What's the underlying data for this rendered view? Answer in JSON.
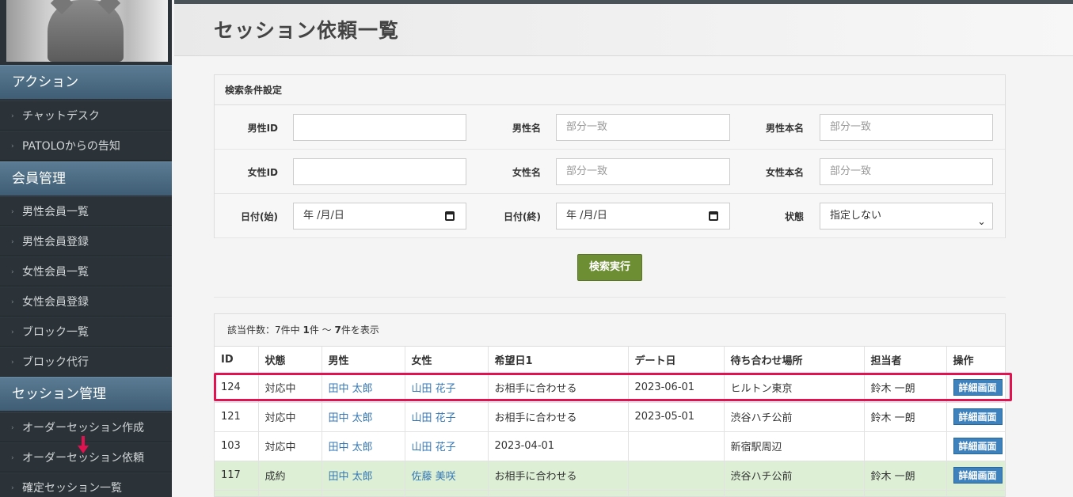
{
  "sidebar": {
    "sections": [
      {
        "title": "アクション",
        "items": [
          "チャットデスク",
          "PATOLOからの告知"
        ]
      },
      {
        "title": "会員管理",
        "items": [
          "男性会員一覧",
          "男性会員登録",
          "女性会員一覧",
          "女性会員登録",
          "ブロック一覧",
          "ブロック代行"
        ]
      },
      {
        "title": "セッション管理",
        "items": [
          "オーダーセッション作成",
          "オーダーセッション依頼",
          "確定セッション一覧"
        ]
      }
    ]
  },
  "page": {
    "title": "セッション依頼一覧"
  },
  "search": {
    "heading": "検索条件設定",
    "fields": {
      "male_id": {
        "label": "男性ID",
        "value": ""
      },
      "male_name": {
        "label": "男性名",
        "placeholder": "部分一致"
      },
      "male_real_name": {
        "label": "男性本名",
        "placeholder": "部分一致"
      },
      "female_id": {
        "label": "女性ID",
        "value": ""
      },
      "female_name": {
        "label": "女性名",
        "placeholder": "部分一致"
      },
      "female_real_name": {
        "label": "女性本名",
        "placeholder": "部分一致"
      },
      "date_start": {
        "label": "日付(始)",
        "value": "年 /月/日"
      },
      "date_end": {
        "label": "日付(終)",
        "value": "年 /月/日"
      },
      "status": {
        "label": "状態",
        "value": "指定しない"
      }
    },
    "submit_label": "検索実行"
  },
  "results": {
    "count_prefix": "該当件数：7件中",
    "count_from": "1",
    "count_mid": "件 ～",
    "count_to": "7",
    "count_suffix": "件を表示",
    "columns": [
      "ID",
      "状態",
      "男性",
      "女性",
      "希望日1",
      "デート日",
      "待ち合わせ場所",
      "担当者",
      "操作"
    ],
    "rows": [
      {
        "id": "124",
        "status": "対応中",
        "male": "田中 太郎",
        "female": "山田 花子",
        "wish": "お相手に合わせる",
        "date": "2023-06-01",
        "place": "ヒルトン東京",
        "staff": "鈴木 一朗",
        "action": "詳細画面",
        "highlight": "green-false"
      },
      {
        "id": "121",
        "status": "対応中",
        "male": "田中 太郎",
        "female": "山田 花子",
        "wish": "お相手に合わせる",
        "date": "2023-05-01",
        "place": "渋谷ハチ公前",
        "staff": "鈴木 一朗",
        "action": "詳細画面"
      },
      {
        "id": "103",
        "status": "対応中",
        "male": "田中 太郎",
        "female": "山田 花子",
        "wish": "2023-04-01",
        "date": "",
        "place": "新宿駅周辺",
        "staff": "",
        "action": "詳細画面"
      },
      {
        "id": "117",
        "status": "成約",
        "male": "田中 太郎",
        "female": "佐藤 美咲",
        "wish": "お相手に合わせる",
        "date": "",
        "place": "渋谷ハチ公前",
        "staff": "鈴木 一朗",
        "action": "詳細画面"
      }
    ]
  },
  "colors": {
    "accent_highlight": "#e0124f",
    "success_row": "#ddf0d5",
    "button_green": "#6e8e33",
    "button_blue": "#3e82bd",
    "link": "#3577b4"
  }
}
